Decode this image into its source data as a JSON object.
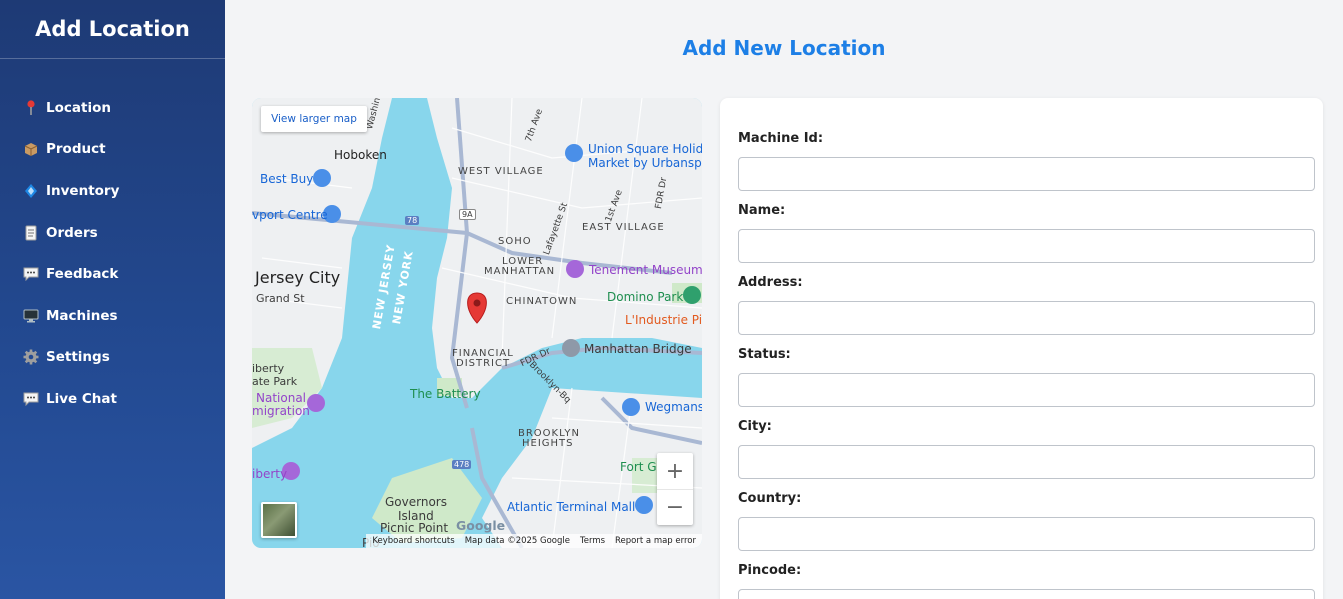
{
  "sidebar": {
    "title": "Add Location",
    "items": [
      {
        "label": "Location",
        "icon": "pin-icon"
      },
      {
        "label": "Product",
        "icon": "package-icon"
      },
      {
        "label": "Inventory",
        "icon": "diamond-icon"
      },
      {
        "label": "Orders",
        "icon": "document-icon"
      },
      {
        "label": "Feedback",
        "icon": "chat-icon"
      },
      {
        "label": "Machines",
        "icon": "monitor-icon"
      },
      {
        "label": "Settings",
        "icon": "gear-icon"
      },
      {
        "label": "Live Chat",
        "icon": "chat-icon"
      }
    ]
  },
  "page": {
    "title": "Add New Location"
  },
  "map": {
    "larger_map_label": "View larger map",
    "zoom_in": "+",
    "zoom_out": "−",
    "google_logo": "Google",
    "footer": {
      "shortcuts": "Keyboard shortcuts",
      "data": "Map data ©2025 Google",
      "terms": "Terms",
      "report": "Report a map error"
    },
    "labels": {
      "hoboken": "Hoboken",
      "best_buy": "Best Buy",
      "port_centre": "vport Centre",
      "jersey_city": "Jersey City",
      "grand_st": "Grand St",
      "west_village": "WEST VILLAGE",
      "union_square": "Union Square Holida",
      "union_square_2": "Market by Urbanspac",
      "east_village": "EAST VILLAGE",
      "soho": "SOHO",
      "lower_manhattan": "LOWER",
      "lower_manhattan_2": "MANHATTAN",
      "tenement": "Tenement Museum",
      "chinatown": "CHINATOWN",
      "domino_park": "Domino Park",
      "lindustrie": "L'Industrie Piz",
      "new_jersey": "NEW JERSEY",
      "new_york": "NEW YORK",
      "financial": "FINANCIAL",
      "district": "DISTRICT",
      "manhattan_bridge": "Manhattan Bridge",
      "liberty": "iberty",
      "state_park": "ate Park",
      "national": "National",
      "migration": "migration",
      "the_battery": "The Battery",
      "wegmans": "Wegmans",
      "brooklyn": "BROOKLYN",
      "heights": "HEIGHTS",
      "liberty2": "iberty",
      "fort_gr": "Fort Gr",
      "governors": "Governors",
      "island": "Island",
      "picnic": "Picnic Point",
      "atlantic": "Atlantic Terminal Mall",
      "pio": "Pio",
      "seventh_ave": "7th Ave",
      "first_ave": "1st Ave",
      "lafayette": "Lafayette St",
      "fdr": "FDR Dr",
      "fdr2": "FDR Dr",
      "brooklyn_bq": "Brooklyn-Bq",
      "washington": "Washin",
      "route_78": "78",
      "route_9a": "9A",
      "route_478": "478"
    }
  },
  "form": {
    "fields": [
      {
        "label": "Machine Id:",
        "value": ""
      },
      {
        "label": "Name:",
        "value": ""
      },
      {
        "label": "Address:",
        "value": ""
      },
      {
        "label": "Status:",
        "value": ""
      },
      {
        "label": "City:",
        "value": ""
      },
      {
        "label": "Country:",
        "value": ""
      },
      {
        "label": "Pincode:",
        "value": ""
      }
    ]
  }
}
